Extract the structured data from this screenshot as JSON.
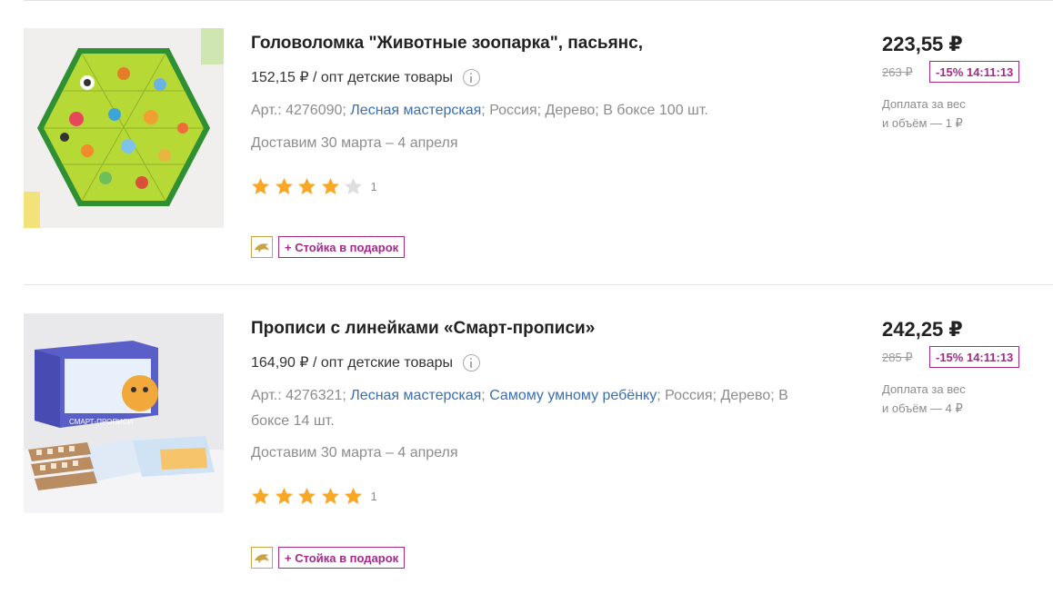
{
  "products": [
    {
      "title": "Головоломка \"Животные зоопарка\", пасьянс,",
      "opt_price": "152,15 ₽ / опт детские товары",
      "article": "Арт.: 4276090;",
      "brand": "Лесная мастерская",
      "series": "",
      "country_material": "; Россия; Дерево; В боксе 100 шт.",
      "delivery": "Доставим 30 марта – 4 апреля",
      "rating": 4,
      "review_count": "1",
      "gift": "+ Стойка в подарок",
      "price": "223,55 ₽",
      "old_price": "263 ₽",
      "discount": "-15% 14:11:13",
      "surcharge_line1": "Доплата за вес",
      "surcharge_line2": "и объём — 1 ₽",
      "image": "hexagon-animal-puzzle"
    },
    {
      "title": "Прописи с линейками «Смарт-прописи»",
      "opt_price": "164,90 ₽ / опт детские товары",
      "article": "Арт.: 4276321;",
      "brand": "Лесная мастерская",
      "series": "Самому умному ребёнку",
      "country_material": "; Россия; Дерево; В боксе 14 шт.",
      "delivery": "Доставим 30 марта – 4 апреля",
      "rating": 5,
      "review_count": "1",
      "gift": "+ Стойка в подарок",
      "price": "242,25 ₽",
      "old_price": "285 ₽",
      "discount": "-15% 14:11:13",
      "surcharge_line1": "Доплата за вес",
      "surcharge_line2": "и объём — 4 ₽",
      "image": "smart-copybook-box"
    }
  ],
  "colors": {
    "star_filled": "#f9a825",
    "star_empty": "#dedede",
    "link": "#3a6fb0",
    "promo_accent": "#a5288a",
    "promo_icon_border": "#c9a34a"
  },
  "icons": [
    "info-icon",
    "star-icon",
    "dolphin-icon"
  ]
}
